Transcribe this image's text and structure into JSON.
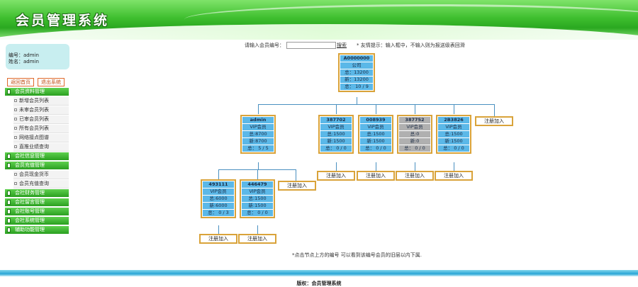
{
  "header": {
    "title": "会员管理系统"
  },
  "user": {
    "id_line": "编号：admin",
    "name_line": "姓名：admin"
  },
  "top_buttons": {
    "home": "返回首页",
    "logout": "退出系统"
  },
  "menu": [
    {
      "label": "会员资料管理",
      "subs": [
        "新增会员列表",
        "未审会员列表",
        "已审会员列表",
        "所有会员列表",
        "网络接点图谱",
        "直推业绩查询"
      ]
    },
    {
      "label": "会社信息管理",
      "subs": []
    },
    {
      "label": "会员充值管理",
      "subs": [
        "会员现金货币",
        "会员充值查询"
      ]
    },
    {
      "label": "会社财务管理",
      "subs": []
    },
    {
      "label": "会社留言管理",
      "subs": []
    },
    {
      "label": "会社账号管理",
      "subs": []
    },
    {
      "label": "会社系统管理",
      "subs": []
    },
    {
      "label": "辅助功能管理",
      "subs": []
    }
  ],
  "search": {
    "label": "请输入会员编号：",
    "placeholder": "",
    "button": "搜索",
    "tip": "* 友情提示：输入框中，不输入则为报送级表回滑"
  },
  "tree": {
    "root": {
      "id": "A0000000",
      "level": "公司",
      "total": "总：13200",
      "new": "新：13200",
      "ratio": "总： 10 / 9"
    },
    "level2": [
      {
        "id": "admin",
        "level": "VIP会员",
        "total": "总:8700",
        "new": "新:8700",
        "ratio": "总： 5 / 5"
      },
      {
        "id": "387702",
        "level": "VIP会员",
        "total": "总:1500",
        "new": "新:1500",
        "ratio": "总： 0 / 0"
      },
      {
        "id": "008939",
        "level": "VIP会员",
        "total": "总:1500",
        "new": "新:1500",
        "ratio": "总： 0 / 0"
      },
      {
        "id": "387752",
        "level": "VIP会员",
        "total": "总:0",
        "new": "新:0",
        "ratio": "总： 0 / 0"
      },
      {
        "id": "2B3826",
        "level": "VIP会员",
        "total": "总:1500",
        "new": "新:1500",
        "ratio": "总： 0 / 0"
      }
    ],
    "level3": [
      {
        "id": "493111",
        "level": "VIP会员",
        "total": "总:6000",
        "new": "新:6000",
        "ratio": "总： 0 / 3"
      },
      {
        "id": "446479",
        "level": "VIP会员",
        "total": "总:1500",
        "new": "新:1500",
        "ratio": "总： 0 / 0"
      }
    ],
    "register_label": "注册加入"
  },
  "note": "*点击节点上方的编号 可以看到该编号会员的旧层以内下属.",
  "footer": "版权：会员管理系统"
}
